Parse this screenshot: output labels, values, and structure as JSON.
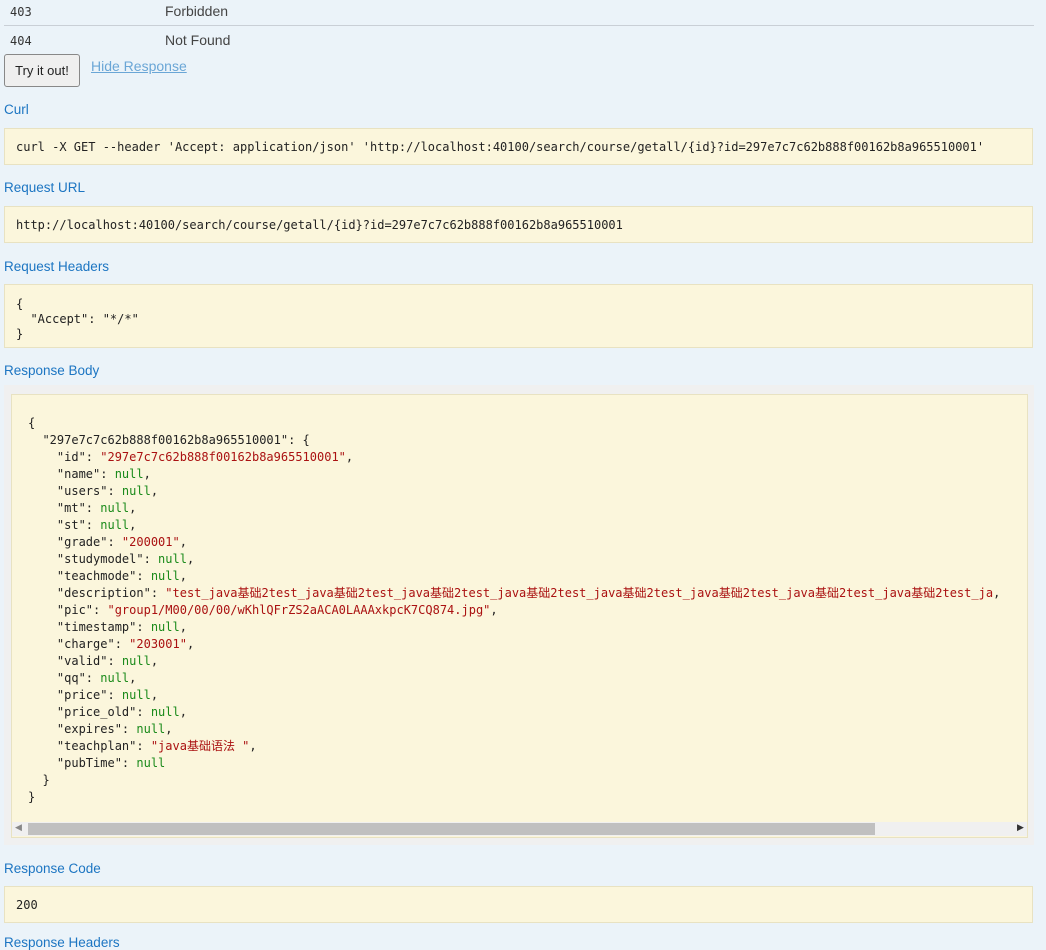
{
  "status_rows": [
    {
      "code": "403",
      "desc": "Forbidden"
    },
    {
      "code": "404",
      "desc": "Not Found"
    }
  ],
  "actions": {
    "try_label": "Try it out!",
    "hide_label": "Hide Response"
  },
  "curl": {
    "label": "Curl",
    "value": "curl -X GET --header 'Accept: application/json' 'http://localhost:40100/search/course/getall/{id}?id=297e7c7c62b888f00162b8a965510001'"
  },
  "request_url": {
    "label": "Request URL",
    "value": "http://localhost:40100/search/course/getall/{id}?id=297e7c7c62b888f00162b8a965510001"
  },
  "request_headers": {
    "label": "Request Headers",
    "value": "{\n  \"Accept\": \"*/*\"\n}"
  },
  "response_body": {
    "label": "Response Body",
    "root_key": "297e7c7c62b888f00162b8a965510001",
    "fields": [
      {
        "key": "id",
        "value": "\"297e7c7c62b888f00162b8a965510001\"",
        "type": "string"
      },
      {
        "key": "name",
        "value": "null",
        "type": "null"
      },
      {
        "key": "users",
        "value": "null",
        "type": "null"
      },
      {
        "key": "mt",
        "value": "null",
        "type": "null"
      },
      {
        "key": "st",
        "value": "null",
        "type": "null"
      },
      {
        "key": "grade",
        "value": "\"200001\"",
        "type": "string"
      },
      {
        "key": "studymodel",
        "value": "null",
        "type": "null"
      },
      {
        "key": "teachmode",
        "value": "null",
        "type": "null"
      },
      {
        "key": "description",
        "value": "\"test_java基础2test_java基础2test_java基础2test_java基础2test_java基础2test_java基础2test_java基础2test_java基础2test_ja",
        "type": "string"
      },
      {
        "key": "pic",
        "value": "\"group1/M00/00/00/wKhlQFrZS2aACA0LAAAxkpcK7CQ874.jpg\"",
        "type": "string"
      },
      {
        "key": "timestamp",
        "value": "null",
        "type": "null"
      },
      {
        "key": "charge",
        "value": "\"203001\"",
        "type": "string"
      },
      {
        "key": "valid",
        "value": "null",
        "type": "null"
      },
      {
        "key": "qq",
        "value": "null",
        "type": "null"
      },
      {
        "key": "price",
        "value": "null",
        "type": "null"
      },
      {
        "key": "price_old",
        "value": "null",
        "type": "null"
      },
      {
        "key": "expires",
        "value": "null",
        "type": "null"
      },
      {
        "key": "teachplan",
        "value": "\"java基础语法 \"",
        "type": "string"
      },
      {
        "key": "pubTime",
        "value": "null",
        "type": "null"
      }
    ]
  },
  "response_code": {
    "label": "Response Code",
    "value": "200"
  },
  "response_headers": {
    "label": "Response Headers"
  }
}
